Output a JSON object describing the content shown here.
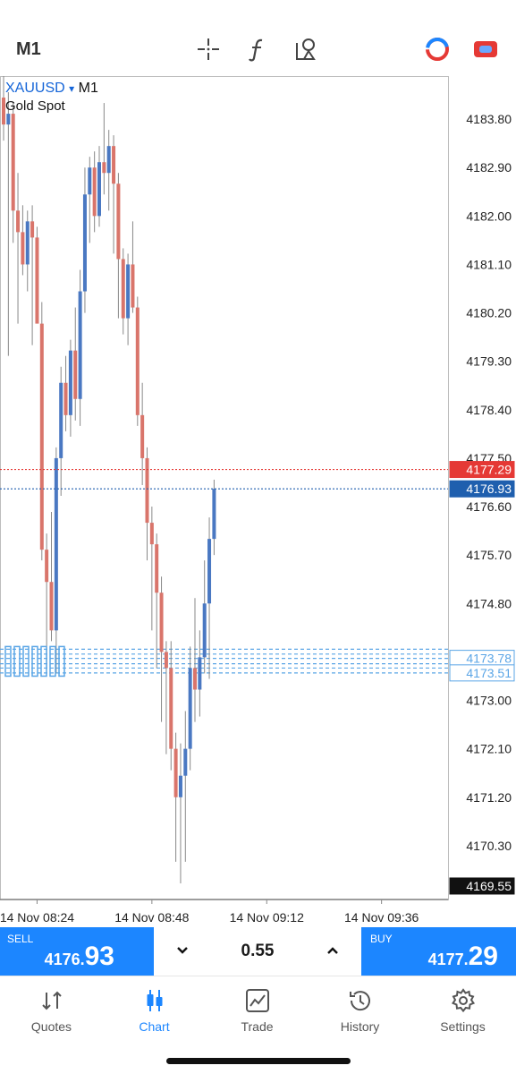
{
  "toolbar": {
    "timeframe": "M1",
    "icons": [
      "crosshair-icon",
      "indicators-icon",
      "objects-icon",
      "trade-toggle-icon",
      "account-icon"
    ]
  },
  "symbol": {
    "name": "XAUUSD",
    "dropdown_glyph": "▾",
    "timeframe": "M1",
    "description": "Gold Spot"
  },
  "colors": {
    "bull": "#4a78c2",
    "bear": "#d9756b",
    "sell_line": "#e53935",
    "bid_line": "#1f5fae",
    "accent": "#1c86ff",
    "order_line": "#5aa5e6"
  },
  "chart_data": {
    "type": "candlestick",
    "y_ticks": [
      "4183.80",
      "4182.90",
      "4182.00",
      "4181.10",
      "4180.20",
      "4179.30",
      "4178.40",
      "4177.50",
      "4176.60",
      "4175.70",
      "4174.80",
      "4173.00",
      "4172.10",
      "4171.20",
      "4170.30"
    ],
    "ylim": [
      4169.3,
      4184.6
    ],
    "x_ticks": [
      {
        "label": "14 Nov 08:24",
        "index": 7
      },
      {
        "label": "14 Nov 08:48",
        "index": 31
      },
      {
        "label": "14 Nov 09:12",
        "index": 55
      },
      {
        "label": "14 Nov 09:36",
        "index": 79
      }
    ],
    "price_labels": [
      {
        "value": 4177.29,
        "text": "4177.29",
        "kind": "ask"
      },
      {
        "value": 4176.93,
        "text": "4176.93",
        "kind": "bid"
      },
      {
        "value": 4173.78,
        "text": "4173.78",
        "kind": "order"
      },
      {
        "value": 4173.51,
        "text": "4173.51",
        "kind": "order"
      },
      {
        "value": 4169.55,
        "text": "4169.55",
        "kind": "low"
      }
    ],
    "order_levels": [
      4173.95,
      4173.86,
      4173.78,
      4173.68,
      4173.6,
      4173.51
    ],
    "candles": [
      {
        "o": 4184.2,
        "h": 4184.6,
        "l": 4183.4,
        "c": 4183.7
      },
      {
        "o": 4183.7,
        "h": 4184.3,
        "l": 4179.4,
        "c": 4183.9
      },
      {
        "o": 4183.9,
        "h": 4184.1,
        "l": 4181.5,
        "c": 4182.1
      },
      {
        "o": 4182.1,
        "h": 4182.8,
        "l": 4180.0,
        "c": 4181.7
      },
      {
        "o": 4181.7,
        "h": 4182.2,
        "l": 4180.9,
        "c": 4181.1
      },
      {
        "o": 4181.1,
        "h": 4182.1,
        "l": 4180.6,
        "c": 4181.9
      },
      {
        "o": 4181.9,
        "h": 4182.2,
        "l": 4179.6,
        "c": 4181.6
      },
      {
        "o": 4181.6,
        "h": 4181.8,
        "l": 4180.3,
        "c": 4180.0
      },
      {
        "o": 4180.0,
        "h": 4180.4,
        "l": 4175.6,
        "c": 4175.8
      },
      {
        "o": 4175.8,
        "h": 4176.1,
        "l": 4173.6,
        "c": 4175.2
      },
      {
        "o": 4175.2,
        "h": 4176.5,
        "l": 4174.1,
        "c": 4174.3
      },
      {
        "o": 4174.3,
        "h": 4177.7,
        "l": 4173.5,
        "c": 4177.5
      },
      {
        "o": 4177.5,
        "h": 4179.2,
        "l": 4176.8,
        "c": 4178.9
      },
      {
        "o": 4178.9,
        "h": 4179.4,
        "l": 4178.0,
        "c": 4178.3
      },
      {
        "o": 4178.3,
        "h": 4179.7,
        "l": 4177.9,
        "c": 4179.5
      },
      {
        "o": 4179.5,
        "h": 4180.3,
        "l": 4178.2,
        "c": 4178.6
      },
      {
        "o": 4178.6,
        "h": 4181.0,
        "l": 4178.1,
        "c": 4180.6
      },
      {
        "o": 4180.6,
        "h": 4182.9,
        "l": 4180.2,
        "c": 4182.4
      },
      {
        "o": 4182.4,
        "h": 4183.1,
        "l": 4181.5,
        "c": 4182.9
      },
      {
        "o": 4182.9,
        "h": 4183.2,
        "l": 4181.7,
        "c": 4182.0
      },
      {
        "o": 4182.0,
        "h": 4183.3,
        "l": 4181.8,
        "c": 4183.0
      },
      {
        "o": 4183.0,
        "h": 4184.1,
        "l": 4182.4,
        "c": 4182.8
      },
      {
        "o": 4182.8,
        "h": 4183.6,
        "l": 4182.1,
        "c": 4183.3
      },
      {
        "o": 4183.3,
        "h": 4183.5,
        "l": 4181.3,
        "c": 4182.6
      },
      {
        "o": 4182.6,
        "h": 4182.8,
        "l": 4180.1,
        "c": 4181.2
      },
      {
        "o": 4181.2,
        "h": 4181.4,
        "l": 4179.8,
        "c": 4180.1
      },
      {
        "o": 4180.1,
        "h": 4181.3,
        "l": 4179.6,
        "c": 4181.1
      },
      {
        "o": 4181.1,
        "h": 4181.9,
        "l": 4180.2,
        "c": 4180.3
      },
      {
        "o": 4180.3,
        "h": 4180.5,
        "l": 4178.1,
        "c": 4178.3
      },
      {
        "o": 4178.3,
        "h": 4178.9,
        "l": 4177.0,
        "c": 4177.5
      },
      {
        "o": 4177.5,
        "h": 4177.7,
        "l": 4175.6,
        "c": 4176.3
      },
      {
        "o": 4176.3,
        "h": 4176.6,
        "l": 4174.3,
        "c": 4175.9
      },
      {
        "o": 4175.9,
        "h": 4176.1,
        "l": 4173.6,
        "c": 4175.0
      },
      {
        "o": 4175.0,
        "h": 4175.3,
        "l": 4172.6,
        "c": 4173.9
      },
      {
        "o": 4173.9,
        "h": 4174.1,
        "l": 4172.0,
        "c": 4173.6
      },
      {
        "o": 4173.6,
        "h": 4174.1,
        "l": 4171.7,
        "c": 4172.1
      },
      {
        "o": 4172.1,
        "h": 4172.4,
        "l": 4170.0,
        "c": 4171.2
      },
      {
        "o": 4171.2,
        "h": 4172.2,
        "l": 4169.6,
        "c": 4171.6
      },
      {
        "o": 4171.6,
        "h": 4172.8,
        "l": 4170.0,
        "c": 4172.1
      },
      {
        "o": 4172.1,
        "h": 4174.0,
        "l": 4171.7,
        "c": 4173.6
      },
      {
        "o": 4173.6,
        "h": 4174.9,
        "l": 4172.6,
        "c": 4173.2
      },
      {
        "o": 4173.2,
        "h": 4174.3,
        "l": 4172.7,
        "c": 4173.8
      },
      {
        "o": 4173.8,
        "h": 4175.6,
        "l": 4173.5,
        "c": 4174.8
      },
      {
        "o": 4174.8,
        "h": 4176.4,
        "l": 4173.4,
        "c": 4176.0
      },
      {
        "o": 4176.0,
        "h": 4177.1,
        "l": 4175.7,
        "c": 4176.93
      }
    ]
  },
  "order_panel": {
    "sell_label": "SELL",
    "sell_price_small": "4176.",
    "sell_price_big": "93",
    "buy_label": "BUY",
    "buy_price_small": "4177.",
    "buy_price_big": "29",
    "lot": "0.55",
    "decrease_glyph": "⌄",
    "increase_glyph": "⌃"
  },
  "nav": {
    "items": [
      {
        "label": "Quotes",
        "icon": "quotes-icon"
      },
      {
        "label": "Chart",
        "icon": "chart-icon",
        "active": true
      },
      {
        "label": "Trade",
        "icon": "trade-icon"
      },
      {
        "label": "History",
        "icon": "history-icon"
      },
      {
        "label": "Settings",
        "icon": "settings-icon"
      }
    ]
  }
}
